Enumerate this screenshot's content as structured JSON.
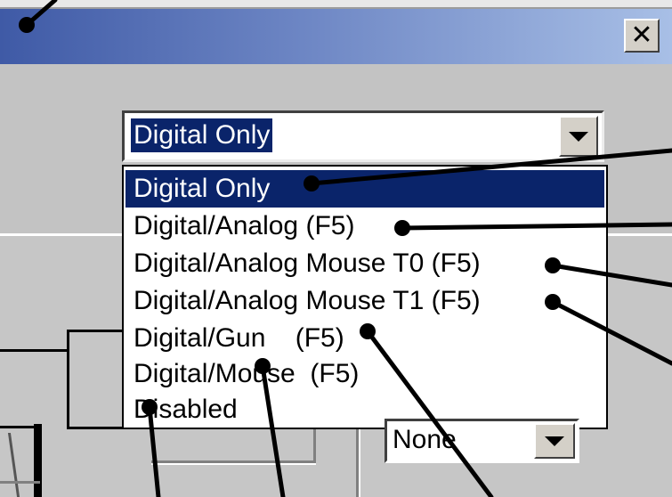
{
  "window": {
    "close_glyph": "✕"
  },
  "combo": {
    "selected_value": "Digital Only"
  },
  "dropdown": {
    "options": [
      {
        "label": "Digital Only"
      },
      {
        "label": "Digital/Analog (F5)"
      },
      {
        "label": "Digital/Analog Mouse T0 (F5)"
      },
      {
        "label": "Digital/Analog Mouse T1 (F5)"
      },
      {
        "label": "Digital/Gun    (F5)"
      },
      {
        "label": "Digital/Mouse  (F5)"
      },
      {
        "label": "Disabled"
      }
    ],
    "selected_index": 0
  },
  "select2": {
    "value": "None"
  },
  "colors": {
    "selection": "#0a246a",
    "titlebar_start": "#3f5aa6",
    "titlebar_end": "#a8bfe6",
    "face": "#c3c3c3",
    "callout": "#000000"
  },
  "icons": {
    "dropdown_arrow": "chevron-down-icon",
    "close": "close-icon"
  }
}
